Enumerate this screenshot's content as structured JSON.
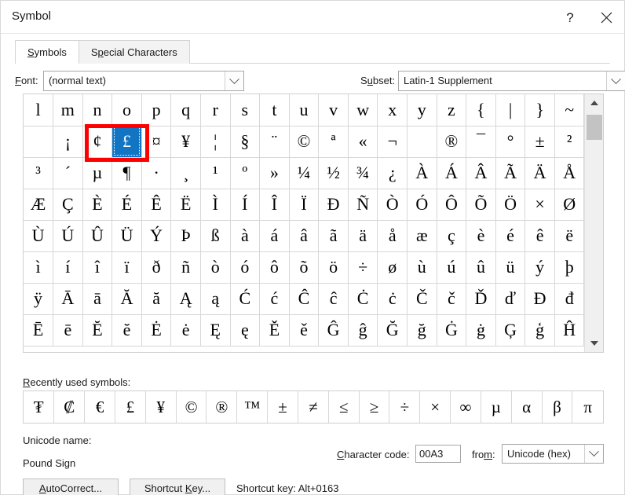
{
  "window": {
    "title": "Symbol",
    "help_icon": "?",
    "close_icon": "×"
  },
  "tabs": [
    {
      "label": "Symbols",
      "accel": "S",
      "active": true
    },
    {
      "label": "Special Characters",
      "accel": "p",
      "active": false
    }
  ],
  "font_field": {
    "label": "Font:",
    "accel": "F",
    "value": "(normal text)"
  },
  "subset_field": {
    "label": "Subset:",
    "accel": "u",
    "value": "Latin-1 Supplement"
  },
  "grid": {
    "columns": 19,
    "selected_row": 1,
    "selected_col": 3,
    "highlight_row": 1,
    "highlight_cols": [
      2,
      3
    ],
    "rows": [
      [
        "l",
        "m",
        "n",
        "o",
        "p",
        "q",
        "r",
        "s",
        "t",
        "u",
        "v",
        "w",
        "x",
        "y",
        "z",
        "{",
        "|",
        "}",
        "~"
      ],
      [
        " ",
        "¡",
        "¢",
        "£",
        "¤",
        "¥",
        "¦",
        "§",
        "¨",
        "©",
        "ª",
        "«",
        "¬",
        "­",
        "®",
        "¯",
        "°",
        "±",
        "²"
      ],
      [
        "³",
        "´",
        "µ",
        "¶",
        "·",
        "¸",
        "¹",
        "º",
        "»",
        "¼",
        "½",
        "¾",
        "¿",
        "À",
        "Á",
        "Â",
        "Ã",
        "Ä",
        "Å"
      ],
      [
        "Æ",
        "Ç",
        "È",
        "É",
        "Ê",
        "Ë",
        "Ì",
        "Í",
        "Î",
        "Ï",
        "Ð",
        "Ñ",
        "Ò",
        "Ó",
        "Ô",
        "Õ",
        "Ö",
        "×",
        "Ø"
      ],
      [
        "Ù",
        "Ú",
        "Û",
        "Ü",
        "Ý",
        "Þ",
        "ß",
        "à",
        "á",
        "â",
        "ã",
        "ä",
        "å",
        "æ",
        "ç",
        "è",
        "é",
        "ê",
        "ë"
      ],
      [
        "ì",
        "í",
        "î",
        "ï",
        "ð",
        "ñ",
        "ò",
        "ó",
        "ô",
        "õ",
        "ö",
        "÷",
        "ø",
        "ù",
        "ú",
        "û",
        "ü",
        "ý",
        "þ"
      ],
      [
        "ÿ",
        "Ā",
        "ā",
        "Ă",
        "ă",
        "Ą",
        "ą",
        "Ć",
        "ć",
        "Ĉ",
        "ĉ",
        "Ċ",
        "ċ",
        "Č",
        "č",
        "Ď",
        "ď",
        "Đ",
        "đ"
      ],
      [
        "Ē",
        "ē",
        "Ĕ",
        "ĕ",
        "Ė",
        "ė",
        "Ę",
        "ę",
        "Ě",
        "ě",
        "Ĝ",
        "ĝ",
        "Ğ",
        "ğ",
        "Ġ",
        "ġ",
        "Ģ",
        "ģ",
        "Ĥ"
      ]
    ],
    "scrollbar": {
      "up_icon": "chevron-up-icon",
      "down_icon": "chevron-down-icon"
    }
  },
  "recent": {
    "label": "Recently used symbols:",
    "accel": "R",
    "symbols": [
      "₮",
      "₡",
      "€",
      "£",
      "¥",
      "©",
      "®",
      "™",
      "±",
      "≠",
      "≤",
      "≥",
      "÷",
      "×",
      "∞",
      "µ",
      "α",
      "β",
      "π"
    ]
  },
  "unicode_name": {
    "label": "Unicode name:",
    "value": "Pound Sign"
  },
  "character_code": {
    "label": "Character code:",
    "accel": "C",
    "value": "00A3"
  },
  "from_field": {
    "label": "from:",
    "accel": "m",
    "value": "Unicode (hex)"
  },
  "buttons": {
    "autocorrect": "AutoCorrect...",
    "autocorrect_accel": "A",
    "shortcut_key": "Shortcut Key...",
    "shortcut_key_accel": "K"
  },
  "shortcut_text": "Shortcut key: Alt+0163",
  "colors": {
    "selection_blue": "#1175c4",
    "annotation_red": "#ff0000",
    "dialog_bg": "#ffffff",
    "button_bg": "#f0f0f0"
  }
}
